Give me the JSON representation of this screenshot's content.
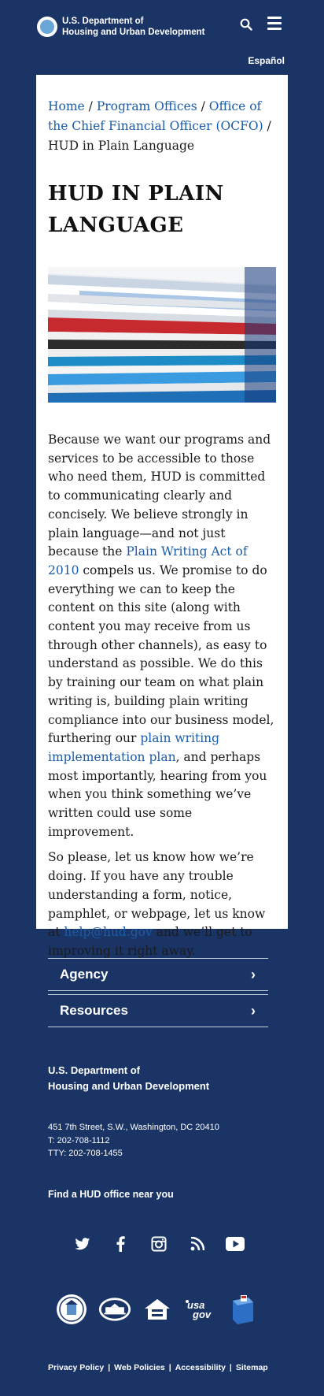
{
  "header": {
    "logo_line1": "U.S. Department of",
    "logo_line2": "Housing and Urban Development",
    "search_icon": "search-icon",
    "menu_icon": "hamburger-menu-icon",
    "language_link": "Español"
  },
  "breadcrumb": {
    "home": "Home",
    "sep1": " / ",
    "program_offices": "Program Offices",
    "sep2": " / ",
    "ocfo": "Office of the Chief Financial Officer (OCFO)",
    "sep3": " / ",
    "current": "HUD in Plain Language"
  },
  "page_title_line1": "HUD IN PLAIN",
  "page_title_line2": "LANGUAGE",
  "paragraph1": {
    "part1": "Because we want our programs and services to be accessible to those who need them, HUD is committed to communicating clearly and concisely. We believe strongly in plain language—and not just because the ",
    "link1": "Plain Writing Act of 2010",
    "part2": " compels us. We promise to do everything we can to keep the content on this site (along with content you may receive from us through other channels), as easy to understand as possible. We do this by training our team on what plain writing is, building plain writing compliance into our business model, furthering our ",
    "link2": "plain writing implementation plan",
    "part3": ", and perhaps most importantly, hearing from you when you think something we’ve written could use some improvement."
  },
  "paragraph2": {
    "part1": "So please, let us know how we’re doing. If you have any trouble understanding a form, notice, pamphlet, or webpage, let us know at ",
    "link": "help@hud.gov",
    "part2": " and we’ll get to improving it right away."
  },
  "footer": {
    "accordion1": "Agency",
    "accordion2": "Resources",
    "org_line1": "U.S. Department of",
    "org_line2": "Housing and Urban Development",
    "address": "451 7th Street, S.W., Washington, DC 20410",
    "phone": "T: 202-708-1112",
    "tty": "TTY: 202-708-1455",
    "find_office": "Find a HUD office near you",
    "social": [
      "twitter-icon",
      "facebook-icon",
      "instagram-icon",
      "rss-icon",
      "youtube-icon"
    ],
    "seals": [
      "hud-seal-icon",
      "white-house-icon",
      "equal-housing-icon",
      "usa-gov-icon",
      "oig-icon"
    ],
    "usagov_text": "usa gov",
    "links": [
      "Privacy Policy",
      "Web Policies",
      "Accessibility",
      "Sitemap"
    ],
    "link_sep": "|"
  },
  "colors": {
    "navy": "#1a3466",
    "link_blue": "#1b5ca9"
  }
}
